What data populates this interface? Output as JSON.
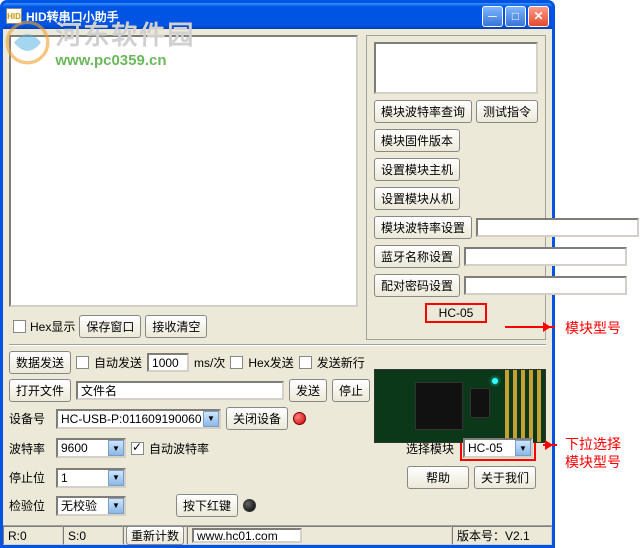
{
  "title": "HID转串口小助手",
  "title_icon": "HID",
  "watermark": {
    "cn": "河东软件园",
    "url": "www.pc0359.cn"
  },
  "rx": {
    "hex_show": "Hex显示",
    "save_window": "保存窗口",
    "rx_clear": "接收清空"
  },
  "right": {
    "baud_query": "模块波特率查询",
    "test_cmd": "测试指令",
    "firmware": "模块固件版本",
    "set_master": "设置模块主机",
    "set_slave": "设置模块从机",
    "baud_set": "模块波特率设置",
    "bt_name_set": "蓝牙名称设置",
    "pair_pwd_set": "配对密码设置",
    "module_badge": "HC-05"
  },
  "tx": {
    "data_send": "数据发送",
    "auto_send": "自动发送",
    "interval": "1000",
    "interval_unit": "ms/次",
    "hex_send": "Hex发送",
    "send_newline": "发送新行",
    "open_file": "打开文件",
    "filename": "文件名",
    "send": "发送",
    "stop": "停止",
    "dev_no_label": "设备号",
    "dev_no": "HC-USB-P:011609190060",
    "close_dev": "关闭设备",
    "baud_label": "波特率",
    "baud": "9600",
    "auto_baud": "自动波特率",
    "stopbit_label": "停止位",
    "stopbit": "1",
    "check_label": "检验位",
    "check": "无校验",
    "red_key": "按下红键",
    "select_module_label": "选择模块",
    "select_module": "HC-05",
    "help": "帮助",
    "about": "关于我们"
  },
  "status": {
    "r": "R:0",
    "s": "S:0",
    "reset_count": "重新计数",
    "url": "www.hc01.com",
    "version": "版本号：V2.1"
  },
  "annotations": {
    "model_label": "模块型号",
    "dropdown_label1": "下拉选择",
    "dropdown_label2": "模块型号"
  }
}
